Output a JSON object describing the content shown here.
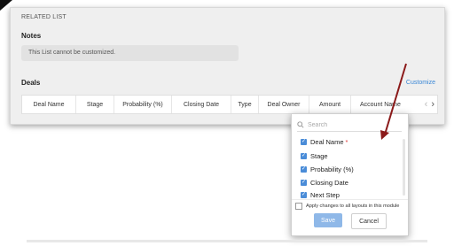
{
  "related_list": {
    "section_title": "RELATED LIST",
    "notes": {
      "title": "Notes",
      "message": "This List cannot be customized."
    },
    "deals": {
      "title": "Deals",
      "customize_label": "Customize",
      "columns": [
        "Deal Name",
        "Stage",
        "Probability (%)",
        "Closing Date",
        "Type",
        "Deal Owner",
        "Amount",
        "Account Name"
      ]
    }
  },
  "dropdown": {
    "search_placeholder": "Search",
    "items": [
      {
        "label": "Deal Name",
        "checked": true,
        "required": "*"
      },
      {
        "label": "Stage",
        "checked": true
      },
      {
        "label": "Probability (%)",
        "checked": true
      },
      {
        "label": "Closing Date",
        "checked": true
      },
      {
        "label": "Next Step",
        "checked": true
      }
    ],
    "apply_label": "Apply changes to all layouts in this module",
    "save_label": "Save",
    "cancel_label": "Cancel"
  },
  "colors": {
    "accent": "#3a87d6",
    "checkbox": "#4a8cd8",
    "save_button": "#8fb8e8",
    "annotation_arrow": "#8b1a1a"
  },
  "icons": [
    "search-icon",
    "chevron-left-icon",
    "chevron-right-icon",
    "checkmark-icon"
  ]
}
